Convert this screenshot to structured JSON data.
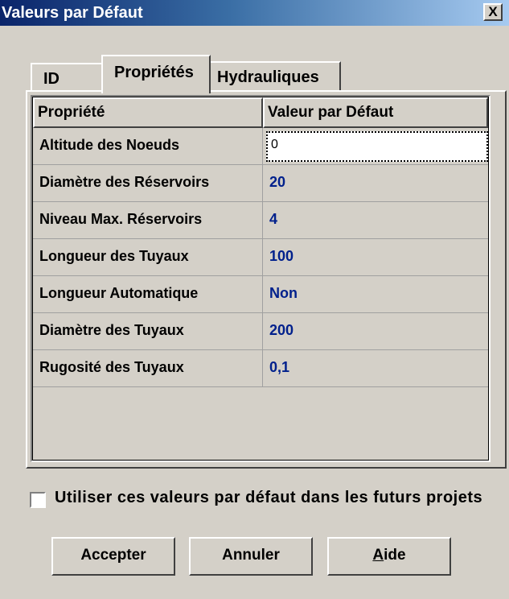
{
  "window": {
    "title": "Valeurs par Défaut",
    "close_glyph": "X"
  },
  "tabs": [
    {
      "label": "ID",
      "active": false
    },
    {
      "label": "Propriétés",
      "active": true
    },
    {
      "label": "Hydrauliques",
      "active": false
    }
  ],
  "grid": {
    "columns": [
      "Propriété",
      "Valeur par Défaut"
    ],
    "rows": [
      {
        "property": "Altitude des Noeuds",
        "value": "0",
        "editing": true
      },
      {
        "property": "Diamètre des Réservoirs",
        "value": "20"
      },
      {
        "property": "Niveau Max. Réservoirs",
        "value": "4"
      },
      {
        "property": "Longueur des Tuyaux",
        "value": "100"
      },
      {
        "property": "Longueur Automatique",
        "value": "Non"
      },
      {
        "property": "Diamètre des Tuyaux",
        "value": "200"
      },
      {
        "property": "Rugosité des Tuyaux",
        "value": "0,1"
      }
    ]
  },
  "checkbox": {
    "label": "Utiliser ces valeurs par défaut dans les futurs projets",
    "checked": false
  },
  "buttons": {
    "accept": "Accepter",
    "cancel": "Annuler",
    "help_mnemonic": "A",
    "help_rest": "ide"
  },
  "colors": {
    "title_gradient_start": "#0a246a",
    "title_gradient_end": "#a6caf0",
    "face": "#d4d0c8",
    "value_text": "#00208c"
  }
}
